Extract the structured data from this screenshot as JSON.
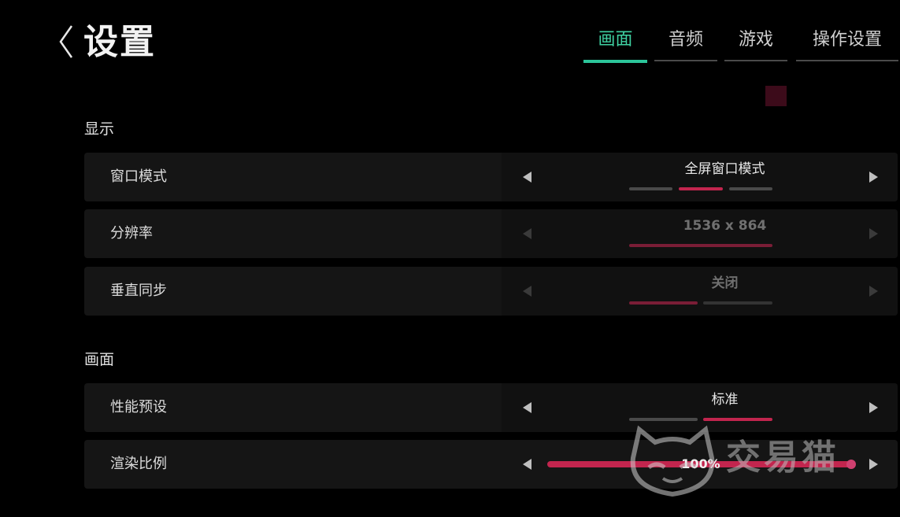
{
  "header": {
    "title": "设置",
    "tabs": [
      {
        "label": "画面",
        "active": true
      },
      {
        "label": "音频",
        "active": false
      },
      {
        "label": "游戏",
        "active": false
      },
      {
        "label": "操作设置",
        "active": false
      }
    ]
  },
  "sections": [
    {
      "title": "显示",
      "rows": [
        {
          "label": "窗口模式",
          "value": "全屏窗口模式",
          "option_count": 3,
          "selected_index": 1,
          "enabled": true
        },
        {
          "label": "分辨率",
          "value": "1536 x 864",
          "option_count": 1,
          "selected_index": 0,
          "enabled": false
        },
        {
          "label": "垂直同步",
          "value": "关闭",
          "option_count": 2,
          "selected_index": 0,
          "enabled": false
        }
      ]
    },
    {
      "title": "画面",
      "rows": [
        {
          "label": "性能预设",
          "value": "标准",
          "option_count": 2,
          "selected_index": 1,
          "enabled": true
        },
        {
          "label": "渲染比例",
          "value": "100%",
          "slider_fraction": 1.0,
          "enabled": true
        }
      ]
    }
  ],
  "watermark": {
    "text": "交易猫"
  },
  "icons": {
    "back": "chevron-left-icon",
    "prev": "triangle-left-icon",
    "next": "triangle-right-icon",
    "record": "record-indicator-icon"
  },
  "colors": {
    "accent_tab": "#2cc59a",
    "selection": "#c2254e",
    "background": "#000000"
  }
}
